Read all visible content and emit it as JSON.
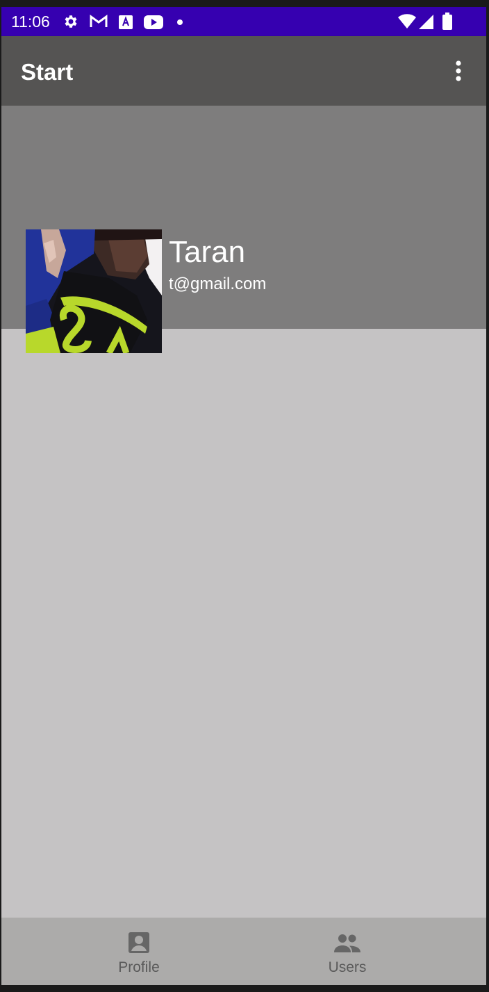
{
  "status_bar": {
    "time": "11:06",
    "background": "#3600b0",
    "left_icons": [
      "gear-icon",
      "gmail-icon",
      "font-a-icon",
      "youtube-icon",
      "dot-icon"
    ],
    "right_icons": [
      "wifi-icon",
      "cellular-signal-icon",
      "battery-icon"
    ]
  },
  "app_bar": {
    "title": "Start",
    "background": "#555453",
    "menu_icon": "more-vert-icon"
  },
  "profile": {
    "name": "Taran",
    "email": "t@gmail.com",
    "header_background": "#7e7d7d",
    "body_background": "#c5c3c4"
  },
  "bottom_nav": {
    "background": "#acabaa",
    "items": [
      {
        "label": "Profile",
        "icon": "account-box-icon"
      },
      {
        "label": "Users",
        "icon": "people-icon"
      }
    ]
  }
}
